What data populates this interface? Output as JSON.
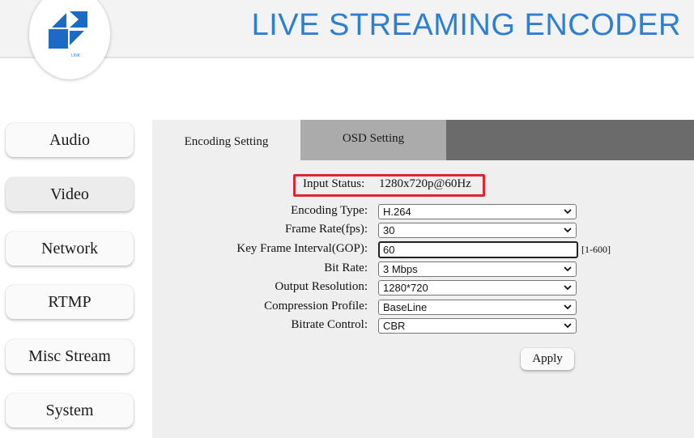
{
  "header": {
    "title": "LIVE STREAMING ENCODER",
    "logo_icon": "brand-logo",
    "logo_caption": "LINK",
    "accent_color": "#2d7fd6"
  },
  "sidebar": {
    "items": [
      {
        "label": "Audio"
      },
      {
        "label": "Video",
        "active": true
      },
      {
        "label": "Network"
      },
      {
        "label": "RTMP"
      },
      {
        "label": "Misc Stream"
      },
      {
        "label": "System"
      }
    ]
  },
  "tabs": [
    {
      "label": "Encoding Setting",
      "active": true
    },
    {
      "label": "OSD Setting"
    }
  ],
  "status": {
    "label": "Input Status:",
    "value": "1280x720p@60Hz",
    "highlight_color": "#e0262c"
  },
  "form": {
    "encoding_type": {
      "label": "Encoding Type:",
      "value": "H.264"
    },
    "frame_rate": {
      "label": "Frame Rate(fps):",
      "value": "30"
    },
    "gop": {
      "label": "Key Frame Interval(GOP):",
      "value": "60",
      "range": "[1-600]"
    },
    "bit_rate": {
      "label": "Bit Rate:",
      "value": "3 Mbps"
    },
    "output_resolution": {
      "label": "Output Resolution:",
      "value": "1280*720"
    },
    "compression_profile": {
      "label": "Compression Profile:",
      "value": "BaseLine"
    },
    "bitrate_control": {
      "label": "Bitrate Control:",
      "value": "CBR"
    },
    "apply_label": "Apply"
  }
}
